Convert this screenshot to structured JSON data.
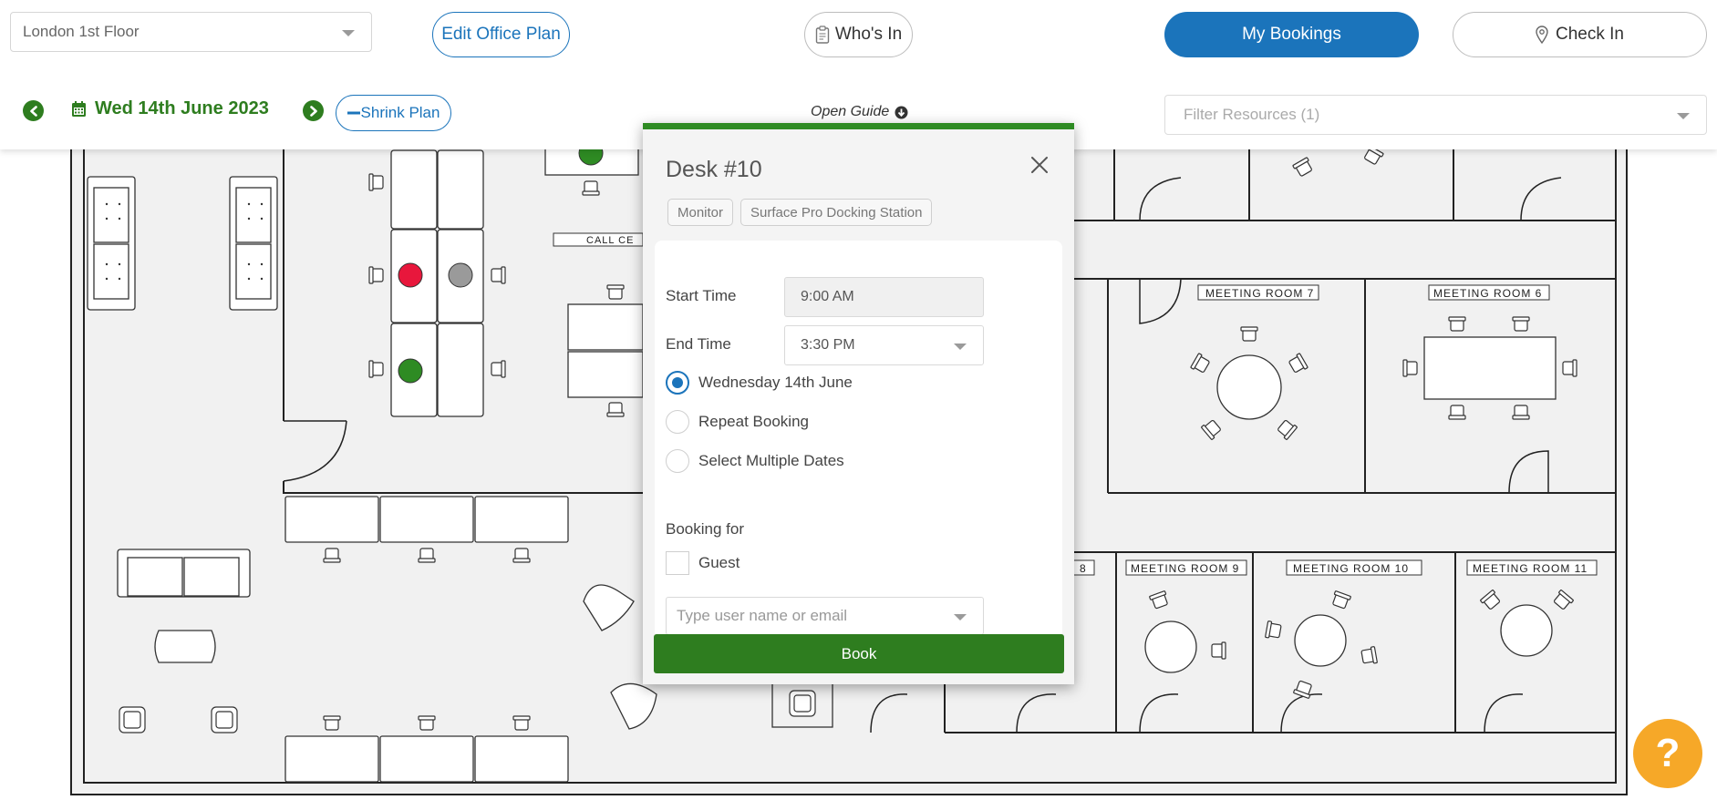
{
  "header": {
    "location": "London 1st Floor",
    "edit_plan_label": "Edit Office Plan",
    "whos_in_label": "Who's In",
    "my_bookings_label": "My Bookings",
    "check_in_label": "Check In",
    "date_label": "Wed 14th June 2023",
    "shrink_plan_label": "Shrink Plan",
    "open_guide_label": "Open Guide",
    "filter_placeholder": "Filter Resources (1)"
  },
  "floorplan": {
    "room_labels": [
      "CALL CE",
      "MEETING ROOM 7",
      "MEETING ROOM 6",
      "8",
      "MEETING ROOM 9",
      "MEETING ROOM 10",
      "MEETING ROOM 11"
    ],
    "desk_status_colors": {
      "available": "#2e8b23",
      "booked": "#e8173c",
      "unavailable": "#9a9a9a"
    }
  },
  "popup": {
    "title": "Desk #10",
    "resources": [
      "Monitor",
      "Surface Pro Docking Station"
    ],
    "start_label": "Start Time",
    "start_value": "9:00 AM",
    "end_label": "End Time",
    "end_value": "3:30 PM",
    "options": [
      {
        "label": "Wednesday 14th June",
        "checked": true
      },
      {
        "label": "Repeat Booking",
        "checked": false
      },
      {
        "label": "Select Multiple Dates",
        "checked": false
      }
    ],
    "booking_for_label": "Booking for",
    "guest_label": "Guest",
    "user_placeholder": "Type user name or email",
    "book_label": "Book"
  },
  "help": {
    "label": "?"
  },
  "colors": {
    "primary": "#1b74bb",
    "green": "#2e7d1f",
    "help": "#f6a828"
  }
}
